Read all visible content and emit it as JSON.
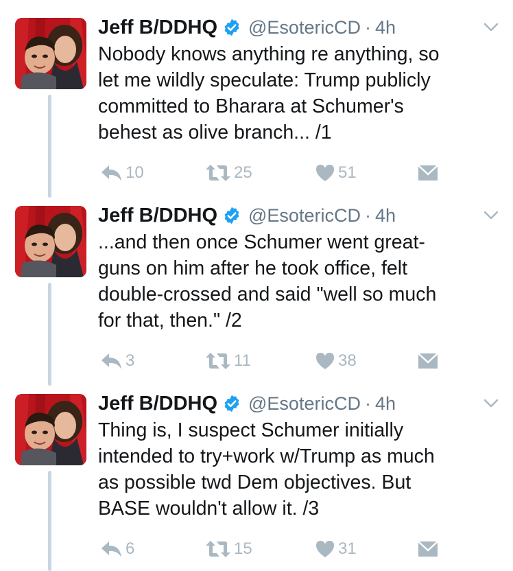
{
  "colors": {
    "text": "#14171a",
    "muted": "#657786",
    "action": "#aab8c2",
    "verified": "#1da1f2",
    "thread_line": "#c8d6e2"
  },
  "icons": {
    "verified": "verified-badge-icon",
    "menu": "chevron-down-icon",
    "reply": "reply-icon",
    "retweet": "retweet-icon",
    "like": "heart-icon",
    "message": "envelope-icon"
  },
  "tweets": [
    {
      "display_name": "Jeff B/DDHQ",
      "handle": "@EsotericCD",
      "separator": "·",
      "time": "4h",
      "text": "Nobody knows anything re anything, so\nlet me wildly speculate: Trump publicly\ncommitted to Bharara at Schumer's\nbehest as olive branch... /1",
      "replies": "10",
      "retweets": "25",
      "likes": "51"
    },
    {
      "display_name": "Jeff B/DDHQ",
      "handle": "@EsotericCD",
      "separator": "·",
      "time": "4h",
      "text": "...and then once Schumer went great-\nguns on him after he took office, felt\ndouble-crossed and said \"well so much\nfor that, then.\" /2",
      "replies": "3",
      "retweets": "11",
      "likes": "38"
    },
    {
      "display_name": "Jeff B/DDHQ",
      "handle": "@EsotericCD",
      "separator": "·",
      "time": "4h",
      "text": "Thing is, I suspect Schumer initially\nintended to try+work w/Trump as much\nas possible twd Dem objectives. But\nBASE wouldn't allow it. /3",
      "replies": "6",
      "retweets": "15",
      "likes": "31"
    }
  ]
}
